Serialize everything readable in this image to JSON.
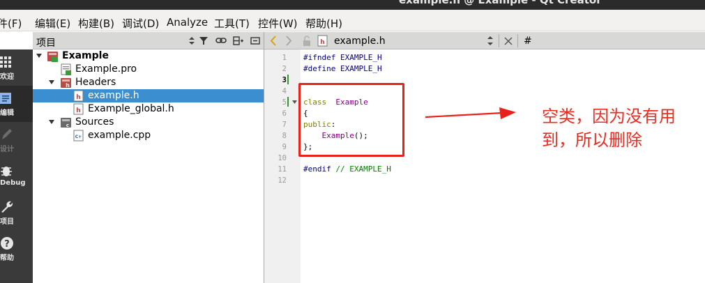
{
  "window": {
    "title": "example.h @ Example - Qt Creator"
  },
  "menubar": {
    "items": [
      "件(F)",
      "编辑(E)",
      "构建(B)",
      "调试(D)",
      "Analyze",
      "工具(T)",
      "控件(W)",
      "帮助(H)"
    ]
  },
  "modes": [
    {
      "label": "欢迎",
      "icon": "grid-icon"
    },
    {
      "label": "编辑",
      "icon": "document-icon"
    },
    {
      "label": "设计",
      "icon": "pencil-icon"
    },
    {
      "label": "Debug",
      "icon": "bug-icon"
    },
    {
      "label": "项目",
      "icon": "wrench-icon"
    },
    {
      "label": "帮助",
      "icon": "help-icon"
    }
  ],
  "project_panel": {
    "title": "项目",
    "tree": [
      {
        "label": "Example",
        "bold": true,
        "selected": false
      },
      {
        "label": "Example.pro",
        "selected": false
      },
      {
        "label": "Headers",
        "selected": false
      },
      {
        "label": "example.h",
        "selected": true
      },
      {
        "label": "Example_global.h",
        "selected": false
      },
      {
        "label": "Sources",
        "selected": false
      },
      {
        "label": "example.cpp",
        "selected": false
      }
    ]
  },
  "editor": {
    "filename": "example.h",
    "hash_label": "#",
    "line_numbers": [
      "1",
      "2",
      "3",
      "4",
      "5",
      "6",
      "7",
      "8",
      "9",
      "10",
      "11",
      "12"
    ],
    "code": {
      "l1_pp": "#ifndef",
      "l1_rest": " EXAMPLE_H",
      "l2_pp": "#define",
      "l2_rest": " EXAMPLE_H",
      "l5_kw": "class",
      "l5_ty": "Example",
      "l6": "{",
      "l7_kw": "public",
      "l7_rest": ":",
      "l8_ty": "Example",
      "l8_rest": "();",
      "l9": "};",
      "l11_pp": "#endif",
      "l11_cm": "// EXAMPLE_H"
    }
  },
  "annotation": {
    "line1": "空类，因为没有用",
    "line2": "到，所以删除",
    "color": "#e8221b"
  }
}
